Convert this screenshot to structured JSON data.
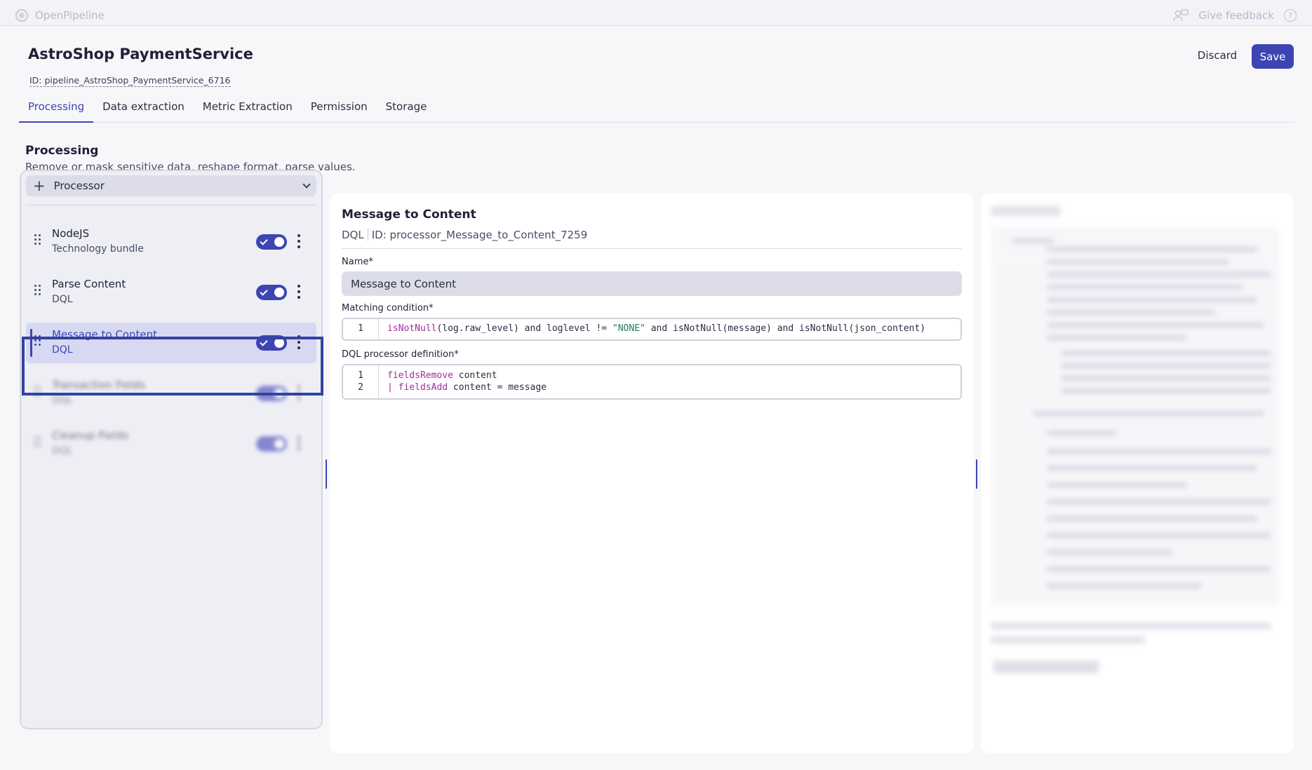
{
  "topbar": {
    "app_name": "OpenPipeline",
    "feedback_label": "Give feedback",
    "help_glyph": "?"
  },
  "header": {
    "title": "AstroShop PaymentService",
    "id": "ID: pipeline_AstroShop_PaymentService_6716",
    "discard_label": "Discard",
    "save_label": "Save"
  },
  "tabs": [
    {
      "label": "Processing",
      "active": true
    },
    {
      "label": "Data extraction",
      "active": false
    },
    {
      "label": "Metric Extraction",
      "active": false
    },
    {
      "label": "Permission",
      "active": false
    },
    {
      "label": "Storage",
      "active": false
    }
  ],
  "section": {
    "title": "Processing",
    "description": "Remove or mask sensitive data, reshape format, parse values."
  },
  "processor_panel": {
    "add_label": "Processor",
    "items": [
      {
        "name": "NodeJS",
        "type": "Technology bundle",
        "enabled": true
      },
      {
        "name": "Parse Content",
        "type": "DQL",
        "enabled": true
      },
      {
        "name": "Message to Content",
        "type": "DQL",
        "enabled": true,
        "selected": true
      },
      {
        "name": "Transaction Fields",
        "type": "DQL",
        "enabled": true
      },
      {
        "name": "Cleanup Fields",
        "type": "DQL",
        "enabled": true
      }
    ]
  },
  "detail": {
    "title": "Message to Content",
    "kind": "DQL",
    "id": "ID: processor_Message_to_Content_7259",
    "name_label": "Name*",
    "name_value": "Message to Content",
    "matching_label": "Matching condition*",
    "matching_line_no": "1",
    "matching_fn1": "isNotNull",
    "matching_rest1": "(log.raw_level) and loglevel != ",
    "matching_str": "\"NONE\"",
    "matching_rest2": " and isNotNull(message) and isNotNull(json_content)",
    "dql_label": "DQL processor definition*",
    "dql_lines": [
      {
        "no": "1",
        "kw": "fieldsRemove",
        "pre": "",
        "rest": " content"
      },
      {
        "no": "2",
        "kw": "fieldsAdd",
        "pre": "| ",
        "rest": " content = message"
      }
    ]
  },
  "colors": {
    "accent": "#3d45b3",
    "keyword": "#a12f9c",
    "string": "#1f7a5c"
  }
}
